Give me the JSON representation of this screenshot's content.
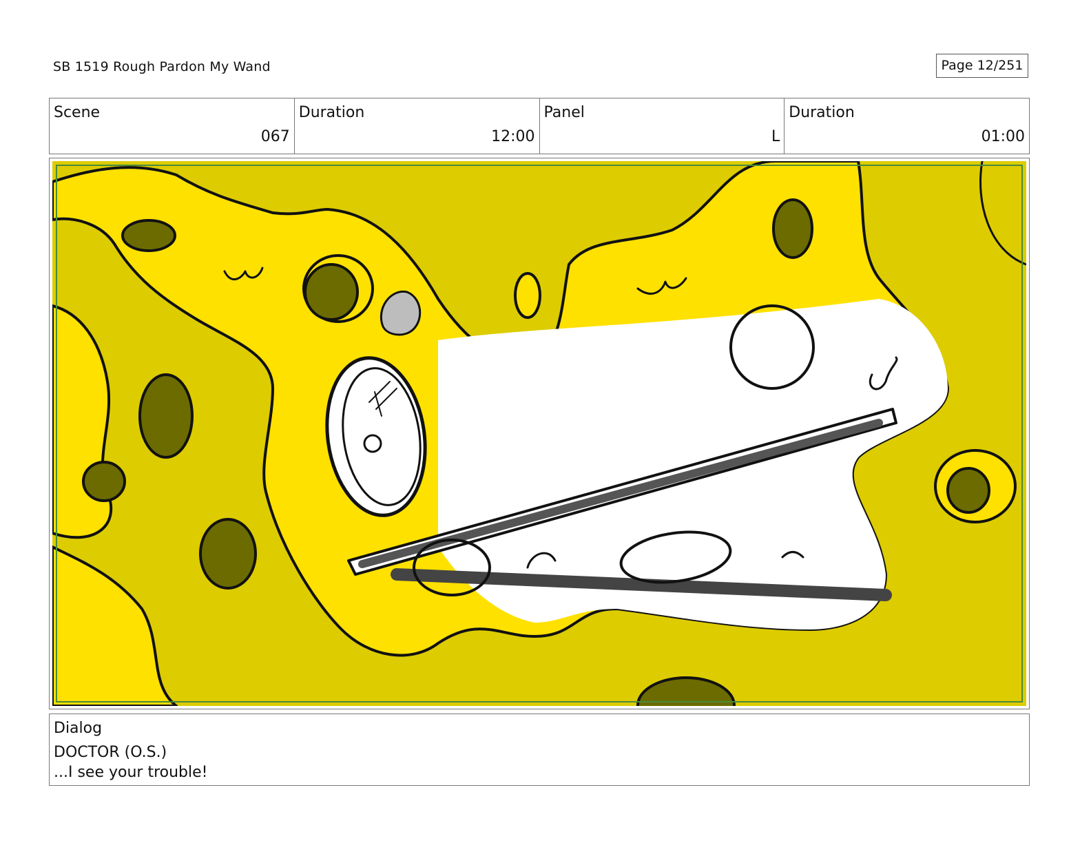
{
  "header": {
    "title": "SB 1519 Rough  Pardon My Wand",
    "page": "Page  12/251"
  },
  "info": {
    "scene_label": "Scene",
    "scene_value": "067",
    "scene_duration_label": "Duration",
    "scene_duration_value": "12:00",
    "panel_label": "Panel",
    "panel_value": "L",
    "panel_duration_label": "Duration",
    "panel_duration_value": "01:00"
  },
  "dialog": {
    "label": "Dialog",
    "speaker": "DOCTOR (O.S.)",
    "line": "...I see your trouble!"
  },
  "colors": {
    "sponge_dark": "#ddcc00",
    "sponge_light": "#ffe100",
    "hole_fill": "#6b6b00",
    "ink": "#111111",
    "panel_border": "#4a8a3a"
  }
}
